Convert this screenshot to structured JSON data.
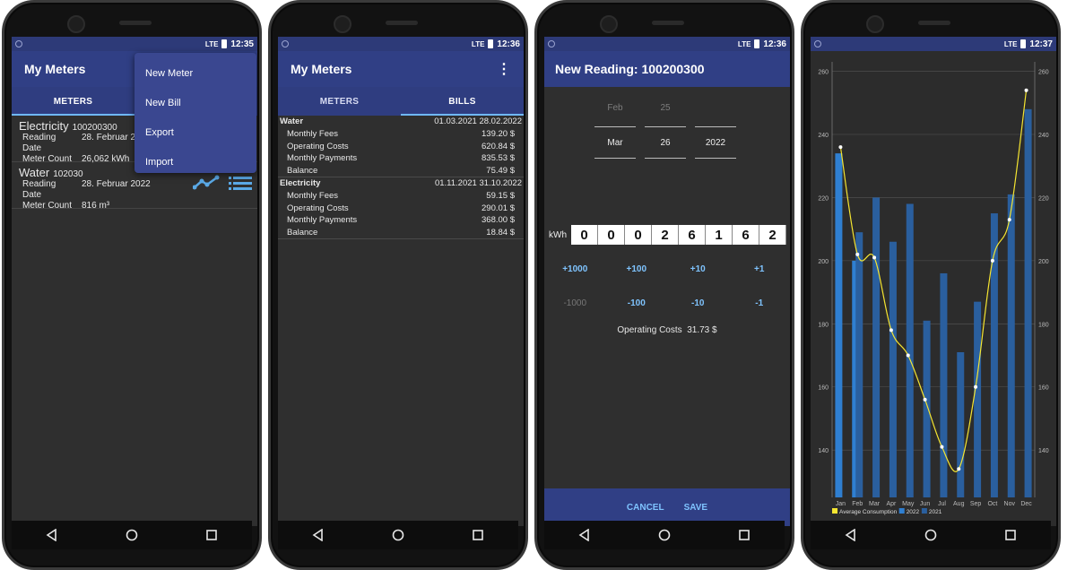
{
  "status": {
    "network": "LTE",
    "times": [
      "12:35",
      "12:36",
      "12:36",
      "12:37"
    ]
  },
  "app": {
    "title": "My Meters",
    "tabs": [
      "METERS",
      "BILLS"
    ]
  },
  "menu": {
    "items": [
      "New Meter",
      "New Bill",
      "Export",
      "Import"
    ]
  },
  "meters": [
    {
      "name": "Electricity",
      "number": "100200300",
      "rows": [
        {
          "k": "Reading Date",
          "v": "28. Februar 2022"
        },
        {
          "k": "Meter Count",
          "v": "26,062 kWh"
        }
      ]
    },
    {
      "name": "Water",
      "number": "102030",
      "rows": [
        {
          "k": "Reading Date",
          "v": "28. Februar 2022"
        },
        {
          "k": "Meter Count",
          "v": "816 m³"
        }
      ]
    }
  ],
  "bills": [
    {
      "name": "Water",
      "from": "01.03.2021",
      "to": "28.02.2022",
      "items": [
        {
          "k": "Monthly Fees",
          "v": "139.20 $"
        },
        {
          "k": "Operating Costs",
          "v": "620.84 $"
        },
        {
          "k": "Monthly Payments",
          "v": "835.53 $"
        },
        {
          "k": "Balance",
          "v": "75.49 $"
        }
      ]
    },
    {
      "name": "Electricity",
      "from": "01.11.2021",
      "to": "31.10.2022",
      "items": [
        {
          "k": "Monthly Fees",
          "v": "59.15 $"
        },
        {
          "k": "Operating Costs",
          "v": "290.01 $"
        },
        {
          "k": "Monthly Payments",
          "v": "368.00 $"
        },
        {
          "k": "Balance",
          "v": "18.84 $"
        }
      ]
    }
  ],
  "reading": {
    "title": "New Reading: 100200300",
    "prev": {
      "month": "Feb",
      "day": "25"
    },
    "cur": {
      "month": "Mar",
      "day": "26",
      "year": "2022"
    },
    "unit": "kWh",
    "digits": [
      "0",
      "0",
      "0",
      "2",
      "6",
      "1",
      "6",
      "2"
    ],
    "inc": [
      "+1000",
      "+100",
      "+10",
      "+1"
    ],
    "dec": [
      "-1000",
      "-100",
      "-10",
      "-1"
    ],
    "op_label": "Operating Costs",
    "op_value": "31.73 $",
    "cancel": "CANCEL",
    "save": "SAVE"
  },
  "chart_data": {
    "type": "bar",
    "categories": [
      "Jan",
      "Feb",
      "Mar",
      "Apr",
      "May",
      "Jun",
      "Jul",
      "Aug",
      "Sep",
      "Oct",
      "Nov",
      "Dec"
    ],
    "series": [
      {
        "name": "2022",
        "color": "#2f7fd1",
        "values": [
          234,
          200,
          0,
          0,
          0,
          0,
          0,
          0,
          0,
          0,
          0,
          0
        ]
      },
      {
        "name": "2021",
        "color": "#2a5f9e",
        "values": [
          0,
          209,
          220,
          206,
          218,
          181,
          196,
          171,
          187,
          215,
          221,
          248
        ]
      }
    ],
    "line": {
      "name": "Average Consumption",
      "color": "#f5e531",
      "values": [
        236,
        202,
        201,
        178,
        170,
        156,
        141,
        134,
        160,
        200,
        213,
        254
      ]
    },
    "yticks": [
      140,
      160,
      180,
      200,
      220,
      240,
      260
    ],
    "ylim": [
      125,
      263
    ],
    "legend": "bottom-left"
  },
  "nav": {
    "back": "back-icon",
    "home": "home-icon",
    "recents": "recents-icon"
  }
}
